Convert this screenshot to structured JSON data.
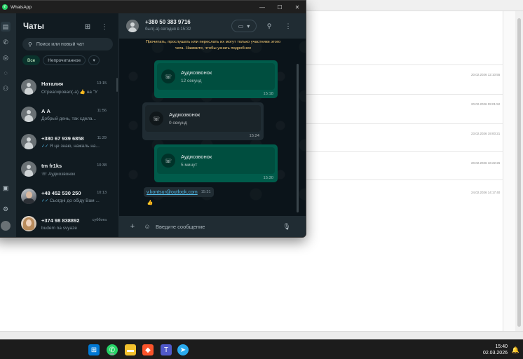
{
  "window": {
    "app_name": "WhatsApp"
  },
  "chat_list": {
    "title": "Чаты",
    "search_placeholder": "Поиск или новый чат",
    "filters": [
      "Все",
      "Непрочитанное"
    ],
    "chats": [
      {
        "name": "Наталия",
        "time": "13:15",
        "preview": "Отреагировал(-а) 👍 на \"У"
      },
      {
        "name": "А А",
        "time": "11:56",
        "preview": "Добрый день, так сдела..."
      },
      {
        "name": "+380 67 939 6858",
        "time": "11:29",
        "preview": "Я це знаю, нажаль на..."
      },
      {
        "name": "tm fr1ks",
        "time": "10:38",
        "preview": "Аудиозвонок"
      },
      {
        "name": "+48 452 530 250",
        "time": "10:13",
        "preview": "Сьогдні до обіду Вам ..."
      },
      {
        "name": "+374 98 838892",
        "time": "суббота",
        "preview": "budem na svyaze"
      }
    ]
  },
  "conversation": {
    "contact": "+380 50 383 9716",
    "status": "был(-а) сегодня в 15:32",
    "notice": "Прочитать, прослушать или переслать их могут только участники этого чата. Нажмите, чтобы узнать подробнее",
    "messages": [
      {
        "title": "Аудиозвонок",
        "sub": "12 секунд",
        "time": "15:18"
      },
      {
        "title": "Аудиозвонок",
        "sub": "0 секунд",
        "time": "15:24"
      },
      {
        "title": "Аудиозвонок",
        "sub": "5 минут",
        "time": "15:30"
      }
    ],
    "link_message": {
      "text": "v.kontsur@outlook.com",
      "time": "15:31",
      "reaction": "👍"
    },
    "composer_placeholder": "Введите сообщение"
  },
  "background": {
    "dates": [
      "20.02.2026 12:10:55",
      "20.02.2026 09:01:52",
      "23.02.2026 19:00:21",
      "20.02.2026 16:22:26",
      "24.02.2026 14:17:40"
    ]
  },
  "taskbar": {
    "time": "15:40",
    "date": "02.03.2026"
  }
}
